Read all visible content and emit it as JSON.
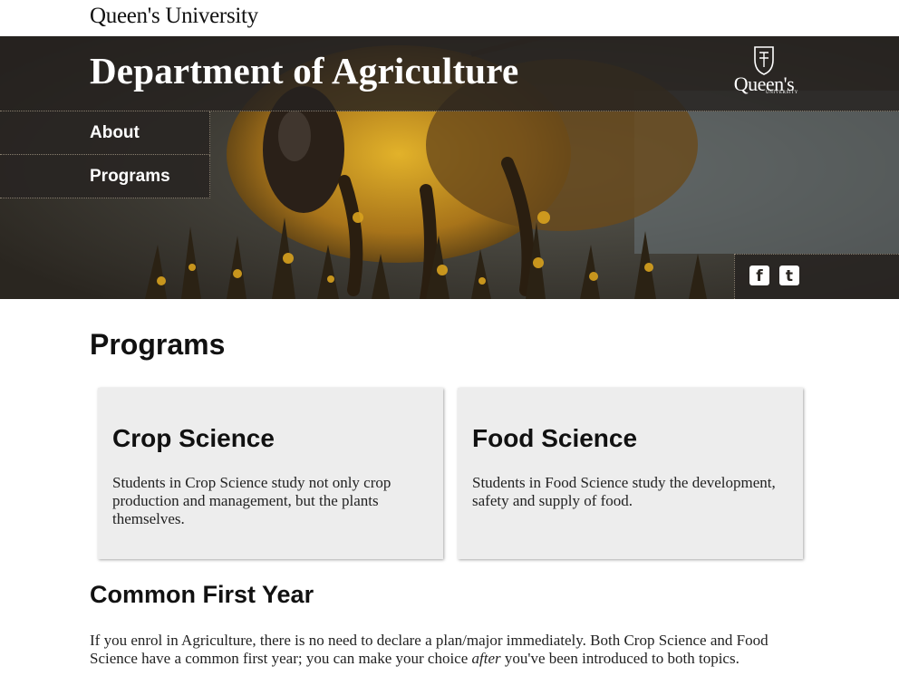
{
  "header": {
    "university_name": "Queen's University",
    "department_title": "Department of Agriculture",
    "crest_word": "Queen's",
    "crest_sub": "UNIVERSITY"
  },
  "nav": {
    "items": [
      {
        "label": "About"
      },
      {
        "label": "Programs"
      }
    ]
  },
  "social": {
    "facebook_glyph": "f",
    "twitter_glyph": "t"
  },
  "main": {
    "heading": "Programs",
    "cards": [
      {
        "title": "Crop Science",
        "text": "Students in Crop Science study not only crop production and management, but the plants themselves."
      },
      {
        "title": "Food Science",
        "text": "Students in Food Science study the development, safety and supply of food."
      }
    ],
    "section_heading": "Common First Year",
    "section_text_before": "If you enrol in Agriculture, there is no need to declare a plan/major immediately. Both Crop Science and Food Science have a common first year; you can make your choice ",
    "section_text_em": "after",
    "section_text_after": " you've been introduced to both topics."
  },
  "colors": {
    "overlay": "#262220",
    "card_bg": "#ededed",
    "pollen": "#d8a21e"
  },
  "icons": [
    "queens-crest-icon",
    "facebook-icon",
    "twitter-icon"
  ]
}
